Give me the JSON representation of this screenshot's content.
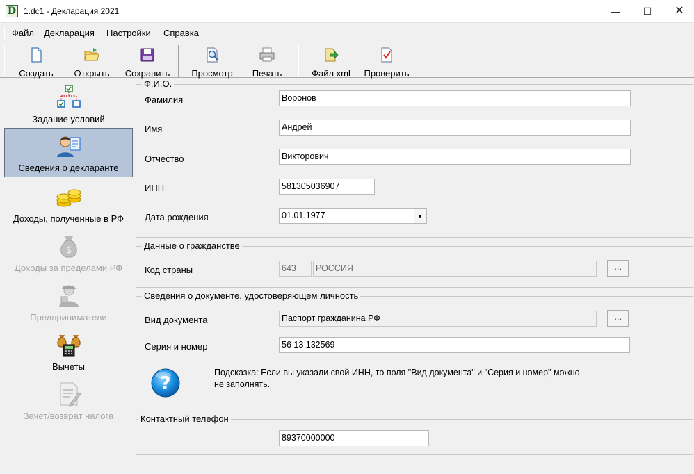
{
  "window": {
    "title": "1.dc1 - Декларация 2021",
    "app_icon_letter": "D",
    "minimize_glyph": "—",
    "maximize_glyph": "☐",
    "close_glyph": "✕"
  },
  "menu": {
    "items": [
      "Файл",
      "Декларация",
      "Настройки",
      "Справка"
    ]
  },
  "toolbar": {
    "buttons": [
      {
        "label": "Создать",
        "icon": "new-document-icon"
      },
      {
        "label": "Открыть",
        "icon": "open-folder-icon"
      },
      {
        "label": "Сохранить",
        "icon": "save-icon"
      },
      {
        "label": "Просмотр",
        "icon": "preview-icon"
      },
      {
        "label": "Печать",
        "icon": "printer-icon"
      },
      {
        "label": "Файл xml",
        "icon": "xml-export-icon"
      },
      {
        "label": "Проверить",
        "icon": "check-document-icon"
      }
    ]
  },
  "sidebar": {
    "items": [
      {
        "label": "Задание условий",
        "icon": "conditions-tree-icon",
        "state": "enabled"
      },
      {
        "label": "Сведения о декларанте",
        "icon": "person-card-icon",
        "state": "active"
      },
      {
        "label": "Доходы, полученные в РФ",
        "icon": "coins-icon",
        "state": "enabled"
      },
      {
        "label": "Доходы за пределами РФ",
        "icon": "money-bag-icon",
        "state": "disabled"
      },
      {
        "label": "Предприниматели",
        "icon": "businessman-icon",
        "state": "disabled"
      },
      {
        "label": "Вычеты",
        "icon": "deductions-icon",
        "state": "enabled"
      },
      {
        "label": "Зачет/возврат налога",
        "icon": "tax-refund-document-icon",
        "state": "disabled"
      }
    ]
  },
  "fio": {
    "legend": "Ф.И.О.",
    "surname_label": "Фамилия",
    "surname": "Воронов",
    "name_label": "Имя",
    "name": "Андрей",
    "patronymic_label": "Отчество",
    "patronymic": "Викторович",
    "inn_label": "ИНН",
    "inn": "581305036907",
    "birthdate_label": "Дата рождения",
    "birthdate": "01.01.1977",
    "dropdown_glyph": "▼"
  },
  "citizenship": {
    "legend": "Данные о гражданстве",
    "country_label": "Код страны",
    "country_code": "643",
    "country_name": "РОССИЯ",
    "browse_label": "..."
  },
  "identity_doc": {
    "legend": "Сведения о документе, удостоверяющем личность",
    "doc_type_label": "Вид документа",
    "doc_type": "Паспорт гражданина РФ",
    "browse_label": "...",
    "series_label": "Серия и номер",
    "series_number": "56 13 132569",
    "hint_line1": "Подсказка: Если вы указали свой ИНН, то поля \"Вид документа\" и \"Серия и номер\" можно",
    "hint_line2": "не заполнять.",
    "hint_icon": "help-question-icon",
    "hint_glyph": "?"
  },
  "contact": {
    "legend": "Контактный телефон",
    "phone": "89370000000"
  },
  "colors": {
    "active_sidebar_bg": "#b5c4d8",
    "window_bg": "#f0f0f0",
    "help_icon_blue": "#1a8fe0"
  }
}
